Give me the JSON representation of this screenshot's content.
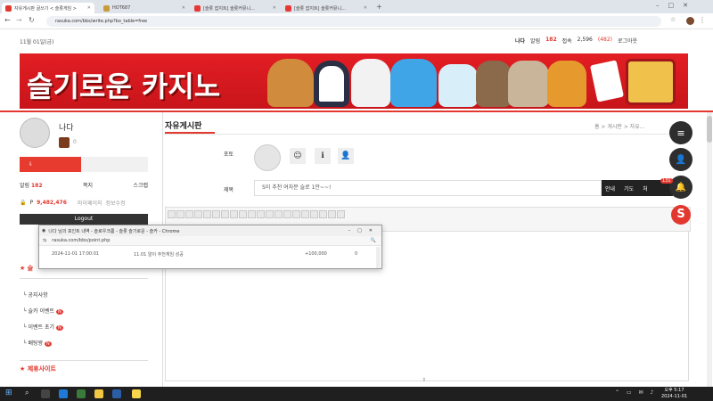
{
  "browser": {
    "tabs": [
      {
        "label": "자유게시판 글쓰기 < 슬롯게임 >"
      },
      {
        "label": "HOT687"
      },
      {
        "label": "[슬롯 잡지트] 슬롯커뮤니..."
      },
      {
        "label": "[슬롯 잡지트] 슬롯커뮤니..."
      }
    ],
    "new_tab": "+",
    "url": "rasuka.com/bbs/write.php?bo_table=free"
  },
  "site": {
    "date": "11월 01일(금)",
    "user": {
      "nickname": "나다",
      "level_label": "알림",
      "level_value": "182",
      "exp_label": "접속",
      "exp_value": "2,596",
      "exp_sub": "(482)",
      "logout": "로그아웃"
    },
    "banner_text": "슬기로운 카지노",
    "profile": {
      "name": "나다",
      "level": "0",
      "stats": [
        {
          "label": "알림",
          "value": "182"
        },
        {
          "label": "쪽지",
          "value": ""
        },
        {
          "label": "스크랩",
          "value": ""
        }
      ],
      "points_label": "P",
      "points_value": "9,482,476",
      "points_links": [
        "마이페이지",
        "정보수정"
      ],
      "logout_button": "Logout"
    },
    "section1_title": "슬",
    "menu": [
      {
        "label": "공지사항",
        "badge": ""
      },
      {
        "label": "슬카 이벤트",
        "badge": "N"
      },
      {
        "label": "이벤트 초기",
        "badge": "N"
      },
      {
        "label": "배팅왕",
        "badge": "N"
      }
    ],
    "section2_title": "제휴사이트",
    "page_title": "자유게시판",
    "breadcrumb": "홈 > 게시판 > 자유...",
    "form": {
      "photo_label": "포토",
      "subject_label": "제목",
      "subject_value": "S이 추천 여자분 슬로 1만~~!"
    },
    "tooltip_items": [
      "안내",
      "기도",
      "처"
    ],
    "notif_count": "131"
  },
  "popup": {
    "title": "나다 님의 포인트 내역 - 슬로우크롬 - 슬롯 슬기로운 - 슬카 - Chrome",
    "url": "rasuka.com/bbs/point.php",
    "row": {
      "datetime": "2024-11-01 17:00:01",
      "content": "11.01 알이 추천게임 성공",
      "amount": "+100,000",
      "balance": "0"
    }
  },
  "taskbar": {
    "time": "오후 5:17",
    "date": "2024-11-01"
  },
  "colors": {
    "accent": "#e2382f",
    "dark": "#2e2e2e",
    "taskbar": "#1f1f1f"
  }
}
